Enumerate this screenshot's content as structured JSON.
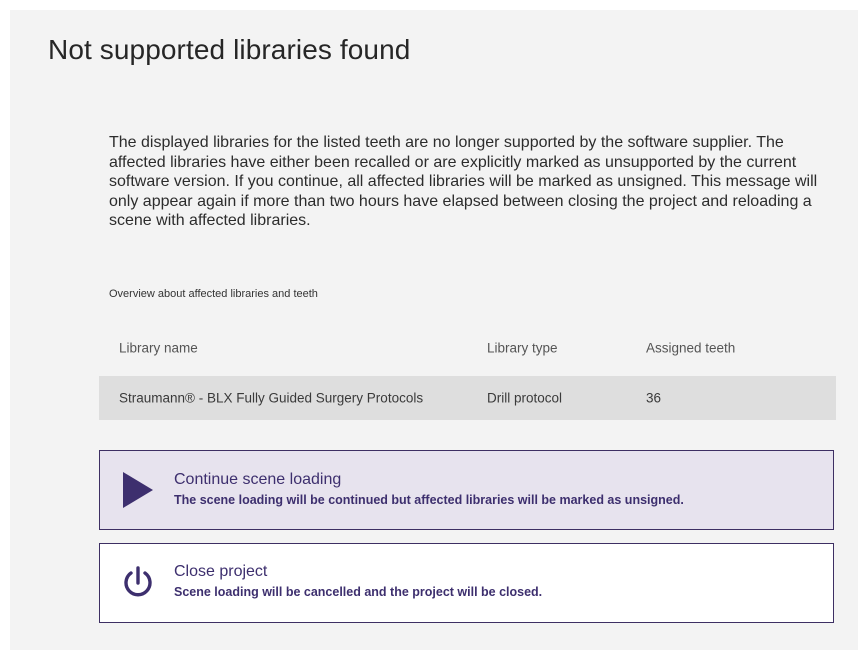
{
  "dialog": {
    "title": "Not supported libraries found",
    "message": "The displayed libraries for the listed teeth are no longer supported by the software supplier. The affected libraries have either been recalled or are explicitly marked as unsupported by the current software version. If you continue, all affected libraries will be marked as unsigned. This message will only appear again if more than two hours have elapsed between closing the project and reloading a scene with affected libraries.",
    "overview_label": "Overview about affected libraries and teeth"
  },
  "table": {
    "headers": {
      "name": "Library name",
      "type": "Library type",
      "teeth": "Assigned teeth"
    },
    "rows": [
      {
        "name": "Straumann® - BLX Fully Guided Surgery Protocols",
        "type": "Drill protocol",
        "teeth": "36"
      }
    ]
  },
  "options": {
    "continue": {
      "icon": "play-icon",
      "title": "Continue scene loading",
      "description": "The scene loading will be continued but affected libraries will be marked as unsigned."
    },
    "close": {
      "icon": "power-icon",
      "title": "Close project",
      "description": "Scene loading will be cancelled and the project will be closed."
    }
  },
  "colors": {
    "accent": "#3d2f6e",
    "dialog_background": "#f3f3f3",
    "row_background": "#dedede",
    "continue_background": "#e7e3ee"
  }
}
